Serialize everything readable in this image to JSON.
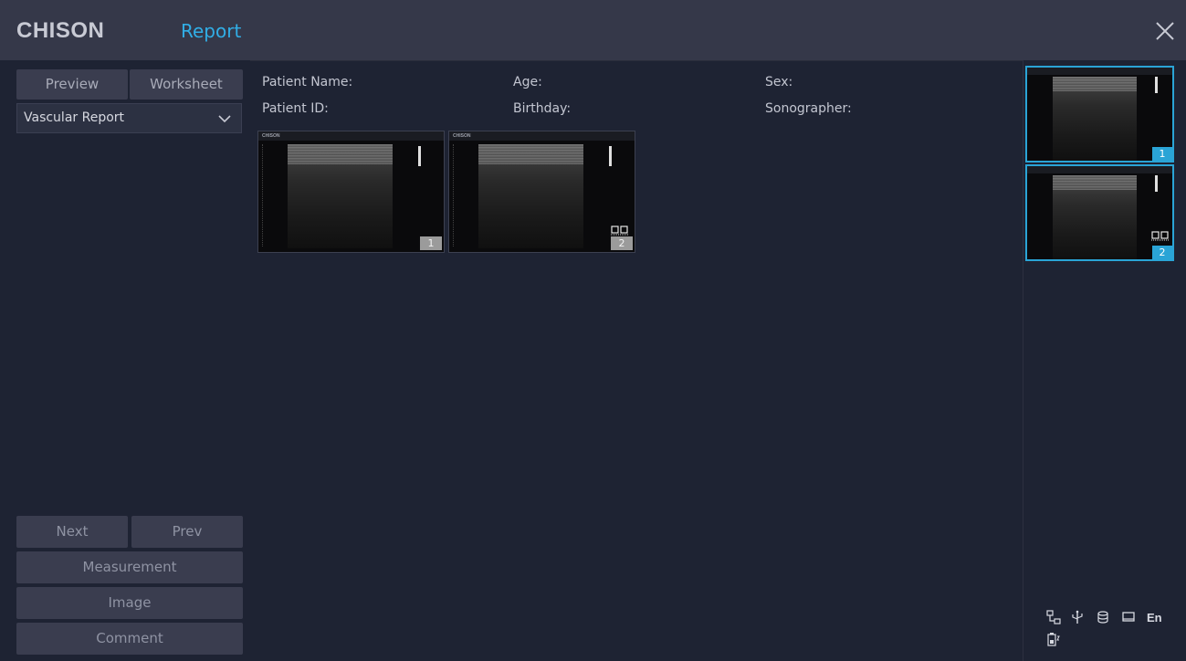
{
  "header": {
    "brand": "CHISON",
    "title": "Report"
  },
  "left_panel": {
    "tabs": [
      {
        "label": "Preview"
      },
      {
        "label": "Worksheet"
      }
    ],
    "report_select": {
      "value": "Vascular Report"
    },
    "buttons": {
      "next": "Next",
      "prev": "Prev",
      "measurement": "Measurement",
      "image": "Image",
      "comment": "Comment"
    }
  },
  "patient_info": {
    "name_label": "Patient Name:",
    "age_label": "Age:",
    "sex_label": "Sex:",
    "id_label": "Patient ID:",
    "birthday_label": "Birthday:",
    "sonographer_label": "Sonographer:"
  },
  "report_images": [
    {
      "number": "1",
      "cine": false
    },
    {
      "number": "2",
      "cine": true
    }
  ],
  "sidebar_images": [
    {
      "number": "1",
      "cine": false,
      "selected": true
    },
    {
      "number": "2",
      "cine": true,
      "selected": true
    }
  ],
  "status_bar": {
    "icons": [
      "network-icon",
      "usb-icon",
      "storage-icon",
      "printer-icon",
      "battery-icon"
    ],
    "language": "En"
  },
  "colors": {
    "accent": "#31aee6",
    "background": "#1e2333",
    "titlebar": "#353849",
    "button": "#3a3d4f"
  }
}
